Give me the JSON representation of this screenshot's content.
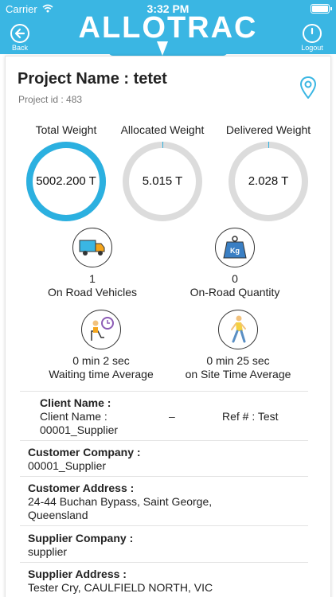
{
  "status_bar": {
    "carrier": "Carrier",
    "time": "3:32 PM"
  },
  "header": {
    "brand": "ALLOTRAC",
    "back_label": "Back",
    "logout_label": "Logout",
    "color": "#3ab6e3"
  },
  "project": {
    "name": "Project Name : tetet",
    "id": "Project id : 483"
  },
  "weights": {
    "total": {
      "title": "Total Weight",
      "value": "5002.200 T",
      "fill": 1.0
    },
    "allocated": {
      "title": "Allocated Weight",
      "value": "5.015 T",
      "fill": 0.001
    },
    "delivered": {
      "title": "Delivered Weight",
      "value": "2.028 T",
      "fill": 0.0004
    }
  },
  "stats": {
    "on_road_vehicles": {
      "value": "1",
      "label": "On Road Vehicles",
      "icon": "truck-icon"
    },
    "on_road_quantity": {
      "value": "0",
      "label": "On-Road Quantity",
      "icon": "kg-weight-icon"
    },
    "waiting_time": {
      "value": "0 min 2 sec",
      "label": "Waiting time Average",
      "icon": "waiting-clock-icon"
    },
    "on_site_time": {
      "value": "0 min 25 sec",
      "label": "on Site Time Average",
      "icon": "walking-person-icon"
    }
  },
  "client": {
    "heading": "Client Name  :",
    "label": "Client Name  :",
    "name": "00001_Supplier",
    "dash": "–",
    "ref": "Ref # : Test"
  },
  "details": {
    "customer_company_label": "Customer Company :",
    "customer_company": "00001_Supplier",
    "customer_address_label": "Customer Address :",
    "customer_address": "24-44 Buchan Bypass, Saint George, Queensland",
    "supplier_company_label": "Supplier Company :",
    "supplier_company": "supplier",
    "supplier_address_label": "Supplier Address :",
    "supplier_address": "Tester Cry, CAULFIELD NORTH, VIC"
  }
}
